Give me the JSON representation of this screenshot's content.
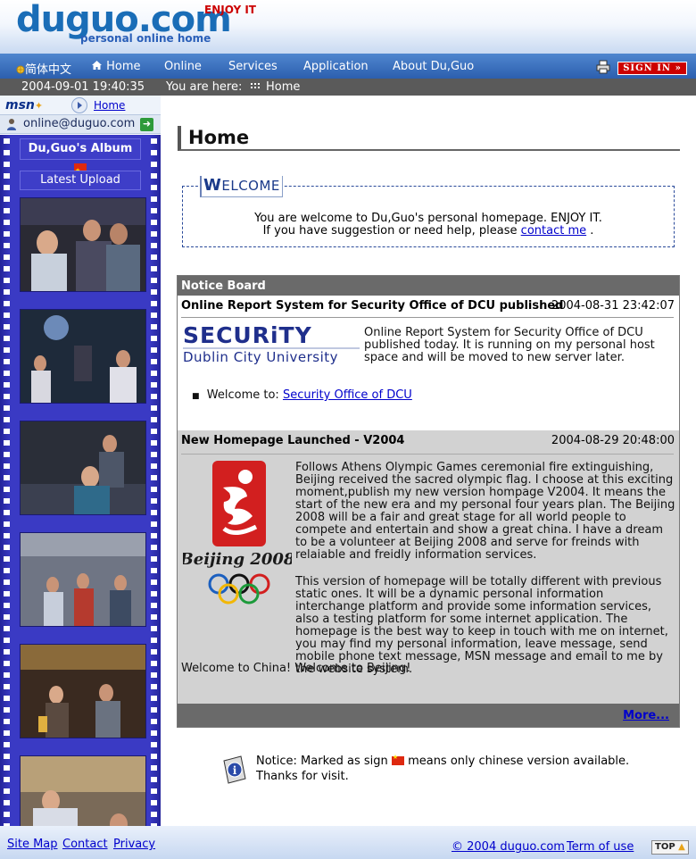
{
  "header": {
    "logo": "duguo.com",
    "tagline": "personal online home",
    "slogan": "ENJOY IT"
  },
  "nav": {
    "chinese": "简体中文",
    "home": "Home",
    "online": "Online",
    "services": "Services",
    "application": "Application",
    "about": "About Du,Guo",
    "signin": "SIGN IN"
  },
  "infobar": {
    "datetime": "2004-09-01 19:40:35",
    "you_are_here": "You are here:",
    "crumb": "Home"
  },
  "sidebar": {
    "msn_logo": "msn",
    "msn_home": "Home",
    "online_email": "online@duguo.com",
    "album_title": "Du,Guo's Album",
    "latest_upload": "Latest Upload",
    "photo_count": 6
  },
  "main": {
    "title": "Home",
    "welcome": {
      "legend_first": "W",
      "legend_rest": "ELCOME",
      "line1": "You are welcome to Du,Guo's personal homepage. ENJOY IT.",
      "line2_pre": "If you have suggestion or need help, please",
      "line2_link": "contact me",
      "line2_post": "."
    },
    "notice_board": {
      "header": "Notice Board",
      "items": [
        {
          "title": "Online Report System for Security Office of DCU published",
          "date": "2004-08-31 23:42:07",
          "logo_line1": "SECURiTY",
          "logo_line2": "Dublin City University",
          "body": "Online Report System for Security Office of DCU published today. It is running on my personal host space and will be moved to new server later.",
          "bullet_label": "Welcome to:",
          "bullet_link": "Security Office of DCU"
        },
        {
          "title": "New Homepage Launched - V2004",
          "date": "2004-08-29 20:48:00",
          "logo_caption": "Beijing 2008",
          "para1": "Follows Athens Olympic Games ceremonial fire extinguishing, Beijing received the sacred olympic flag. I choose at this exciting moment,publish my new version hompage V2004. It means the start of the new era and my personal four years plan. The Beijing 2008 will be a fair and great stage for all world people to compete and entertain and show a great china. I have a dream to be a volunteer at Beijing 2008 and serve for freinds with relaiable and freidly information services.",
          "para2": "This version of homepage will be totally different with previous static ones. It will be a dynamic personal information interchange platform and provide some information services, also a testing platform for some internet application. The homepage is the best way to keep in touch with me on internet, you may find my personal information, leave message, send mobile phone text message, MSN message and email to me by the website system.",
          "para3": "Welcome to China! Welcome to Beijing!"
        }
      ],
      "more": "More..."
    },
    "notice": {
      "pre": "Notice: Marked as sign",
      "post": "means only chinese version available.",
      "line2": "Thanks for visit."
    }
  },
  "footer": {
    "sitemap": "Site Map",
    "contact": "Contact",
    "privacy": "Privacy",
    "copyright": "© 2004 duguo.com",
    "terms": "Term of use",
    "top": "TOP"
  },
  "colors": {
    "nav_bg": "#2c5fae",
    "logo": "#1a6db7",
    "slogan": "#cc0000",
    "film": "#2f2fb0",
    "infobar": "#5a5a5a"
  }
}
